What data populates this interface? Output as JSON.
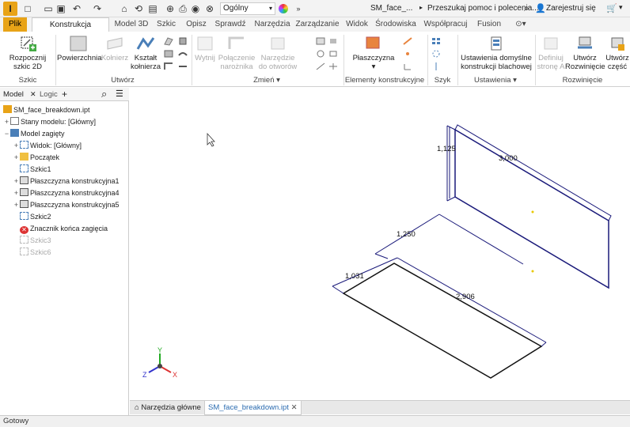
{
  "qat": {
    "app_logo": "I",
    "workspace_select": "Ogólny",
    "document_title": "SM_face_...",
    "help_search": "Przeszukaj pomoc i polecenia...",
    "sign_in": "Zarejestruj się"
  },
  "tabs": [
    "Plik",
    "Konstrukcja blachowa",
    "Model 3D",
    "Szkic",
    "Opisz",
    "Sprawdź",
    "Narzędzia",
    "Zarządzanie",
    "Widok",
    "Środowiska",
    "Współpracuj",
    "Fusion"
  ],
  "ribbon": {
    "sketch": {
      "label": "Rozpocznij\nszkic 2D",
      "group": "Szkic"
    },
    "create": {
      "face": "Powierzchnia",
      "flange": "Kołnierz",
      "contour": "Kształt\nkołnierza",
      "group": "Utwórz"
    },
    "modify": {
      "unfold": "Wytnij",
      "corner": "Połączenie\nnarożnika",
      "hole": "Narzędzie\ndo otworów",
      "group": "Zmień"
    },
    "work": {
      "plane": "Płaszczyzna",
      "group": "Elementy konstrukcyjne"
    },
    "pattern": {
      "group": "Szyk"
    },
    "setup": {
      "defaults": "Ustawienia domyślne\nkonstrukcji blachowej",
      "group": "Ustawienia"
    },
    "flat": {
      "define": "Definiuj\nstronę A",
      "create_flat": "Utwórz\nRozwinięcie",
      "part": "Utwórz\nczęść",
      "group": "Rozwinięcie"
    }
  },
  "browser": {
    "tab_model": "Model",
    "tab_logic": "Logic",
    "items": [
      "SM_face_breakdown.ipt",
      "Stany modelu: [Główny]",
      "Model zagięty",
      "Widok: [Główny]",
      "Początek",
      "Szkic1",
      "Płaszczyzna konstrukcyjna1",
      "Płaszczyzna konstrukcyjna4",
      "Płaszczyzna konstrukcyjna5",
      "Szkic2",
      "Znacznik końca zagięcia",
      "Szkic3",
      "Szkic6"
    ]
  },
  "dimensions": {
    "d1": "1,125",
    "d2": "3,000",
    "d3": "1,250",
    "d4": "1,031",
    "d5": "2,906"
  },
  "triad": {
    "x": "X",
    "y": "Y",
    "z": "Z"
  },
  "doc_tabs": {
    "home": "Narzędzia główne",
    "file": "SM_face_breakdown.ipt"
  },
  "status": "Gotowy"
}
